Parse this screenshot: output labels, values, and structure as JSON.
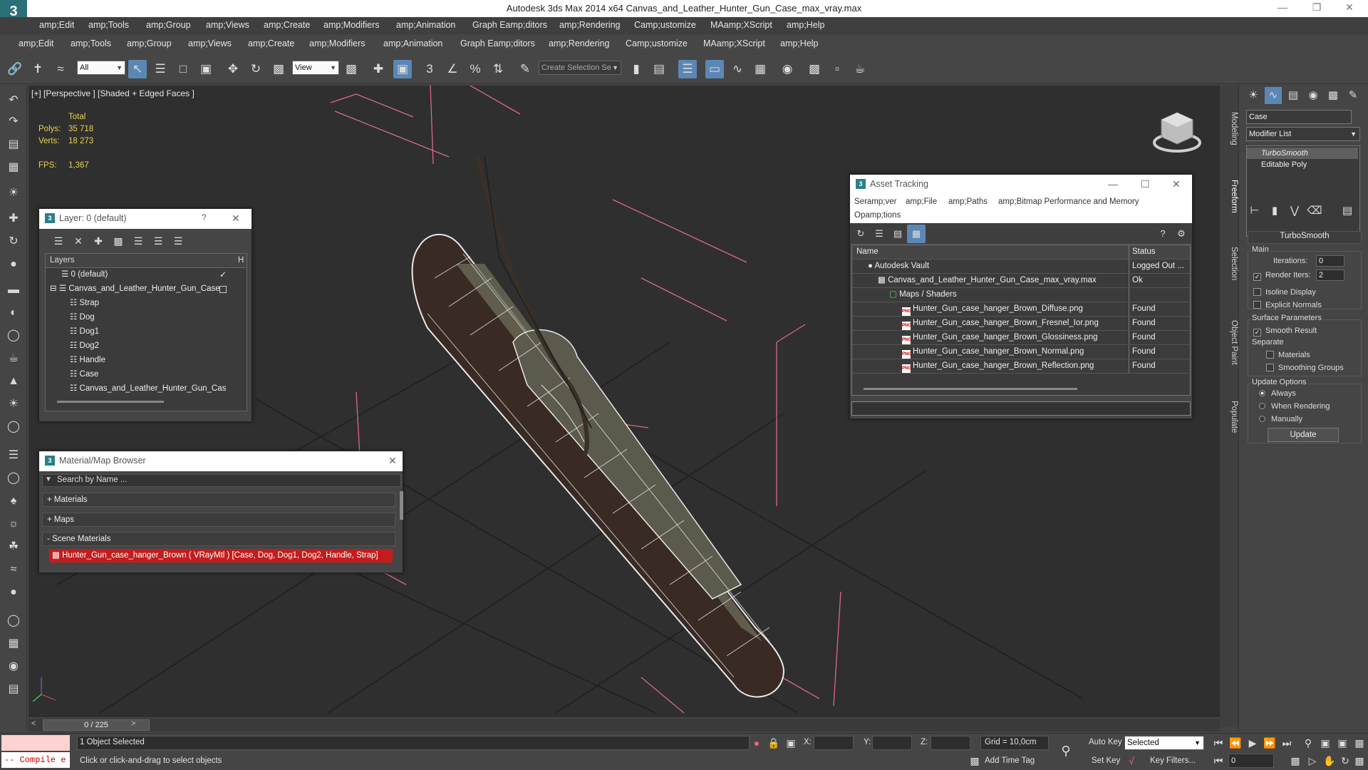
{
  "window": {
    "title": "Autodesk 3ds Max  2014 x64     Canvas_and_Leather_Hunter_Gun_Case_max_vray.max",
    "logo_glyph": "3"
  },
  "menu_primary": [
    "amp;Edit",
    "amp;Tools",
    "amp;Group",
    "amp;Views",
    "amp;Create",
    "amp;Modifiers",
    "amp;Animation",
    "Graph Eamp;ditors",
    "amp;Rendering",
    "Camp;ustomize",
    "MAamp;XScript",
    "amp;Help"
  ],
  "menu_secondary": [
    "amp;Edit",
    "amp;Tools",
    "amp;Group",
    "amp;Views",
    "amp;Create",
    "amp;Modifiers",
    "amp;Animation",
    "Graph Eamp;ditors",
    "amp;Rendering",
    "Camp;ustomize",
    "MAamp;XScript",
    "amp;Help"
  ],
  "toolbar": {
    "selection_filter": "All",
    "reference_coord": "View",
    "named_selection_placeholder": "Create Selection Se"
  },
  "viewport": {
    "label": "[+] [Perspective ] [Shaded + Edged Faces ]",
    "stats": {
      "total_label": "Total",
      "polys_label": "Polys:",
      "polys_value": "35 718",
      "verts_label": "Verts:",
      "verts_value": "18 273",
      "fps_label": "FPS:",
      "fps_value": "1,367"
    }
  },
  "side_tabs": [
    "Modeling",
    "Freeform",
    "Selection",
    "Object Paint",
    "Populate"
  ],
  "layer_dialog": {
    "title": "Layer: 0 (default)",
    "help": "?",
    "col_layers": "Layers",
    "col_h": "H",
    "rows": [
      {
        "label": "0 (default)",
        "indent": 0
      },
      {
        "label": "Canvas_and_Leather_Hunter_Gun_Case",
        "indent": 0
      },
      {
        "label": "Strap",
        "indent": 1
      },
      {
        "label": "Dog",
        "indent": 1
      },
      {
        "label": "Dog1",
        "indent": 1
      },
      {
        "label": "Dog2",
        "indent": 1
      },
      {
        "label": "Handle",
        "indent": 1
      },
      {
        "label": "Case",
        "indent": 1
      },
      {
        "label": "Canvas_and_Leather_Hunter_Gun_Cas",
        "indent": 1
      }
    ]
  },
  "material_browser": {
    "title": "Material/Map Browser",
    "search_placeholder": "Search by Name ...",
    "sections": [
      "+ Materials",
      "+ Maps",
      "- Scene Materials"
    ],
    "scene_material": "Hunter_Gun_case_hanger_Brown  ( VRayMtl ) [Case, Dog, Dog1, Dog2, Handle, Strap]"
  },
  "asset_tracking": {
    "title": "Asset Tracking",
    "menu": [
      "Seramp;ver",
      "amp;File",
      "amp;Paths",
      "amp;Bitmap Performance and Memory",
      "Opamp;tions"
    ],
    "col_name": "Name",
    "col_status": "Status",
    "rows": [
      {
        "name": "Autodesk Vault",
        "status": "Logged Out ...",
        "kind": "vault"
      },
      {
        "name": "Canvas_and_Leather_Hunter_Gun_Case_max_vray.max",
        "status": "Ok",
        "kind": "max"
      },
      {
        "name": "Maps / Shaders",
        "status": "",
        "kind": "folder"
      },
      {
        "name": "Hunter_Gun_case_hanger_Brown_Diffuse.png",
        "status": "Found",
        "kind": "png"
      },
      {
        "name": "Hunter_Gun_case_hanger_Brown_Fresnel_Ior.png",
        "status": "Found",
        "kind": "png"
      },
      {
        "name": "Hunter_Gun_case_hanger_Brown_Glossiness.png",
        "status": "Found",
        "kind": "png"
      },
      {
        "name": "Hunter_Gun_case_hanger_Brown_Normal.png",
        "status": "Found",
        "kind": "png"
      },
      {
        "name": "Hunter_Gun_case_hanger_Brown_Reflection.png",
        "status": "Found",
        "kind": "png"
      }
    ]
  },
  "command_panel": {
    "object_name": "Case",
    "modifier_list": "Modifier List",
    "stack": [
      "TurboSmooth",
      "Editable Poly"
    ],
    "rollout_title": "TurboSmooth",
    "main_label": "Main",
    "iterations_label": "Iterations:",
    "iterations_value": "0",
    "render_iters_label": "Render Iters:",
    "render_iters_value": "2",
    "isoline_label": "Isoline Display",
    "explicit_normals_label": "Explicit Normals",
    "surface_params_label": "Surface Parameters",
    "smooth_result_label": "Smooth Result",
    "separate_label": "Separate",
    "materials_label": "Materials",
    "smoothing_groups_label": "Smoothing Groups",
    "update_options_label": "Update Options",
    "always_label": "Always",
    "when_rendering_label": "When Rendering",
    "manually_label": "Manually",
    "update_button": "Update"
  },
  "timeline": {
    "frame": "0 / 225"
  },
  "status": {
    "maxscript_text": "-- Compile e",
    "selection_info": "1 Object Selected",
    "prompt": "Click or click-and-drag to select objects",
    "x_label": "X:",
    "y_label": "Y:",
    "z_label": "Z:",
    "grid": "Grid = 10,0cm",
    "auto_key": "Auto Key",
    "set_key": "Set Key",
    "key_mode": "Selected",
    "key_filters": "Key Filters...",
    "add_time_tag": "Add Time Tag",
    "current_frame": "0"
  },
  "colors": {
    "accent": "#5b87b5",
    "stats_yellow": "#e6d44a",
    "selected_material": "#c41c1c",
    "grid_pink": "#d86a8a",
    "viewport_bg": "#2f2f2f"
  }
}
